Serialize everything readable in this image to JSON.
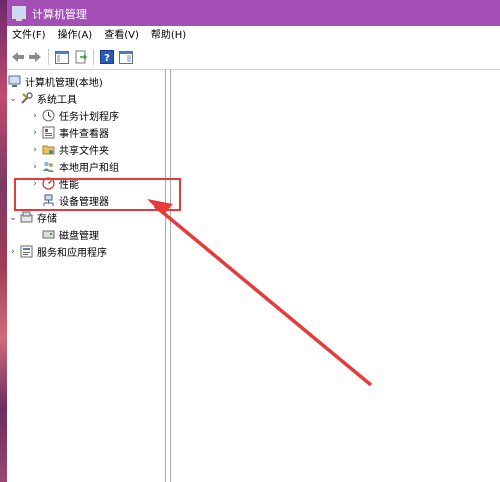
{
  "window": {
    "title": "计算机管理"
  },
  "menu": [
    {
      "label": "文件(F)"
    },
    {
      "label": "操作(A)"
    },
    {
      "label": "查看(V)"
    },
    {
      "label": "帮助(H)"
    }
  ],
  "tree": {
    "root": "计算机管理(本地)",
    "system_tools": "系统工具",
    "task_scheduler": "任务计划程序",
    "event_viewer": "事件查看器",
    "shared_folders": "共享文件夹",
    "local_users": "本地用户和组",
    "performance": "性能",
    "device_manager": "设备管理器",
    "storage": "存储",
    "disk_management": "磁盘管理",
    "services_apps": "服务和应用程序"
  },
  "colors": {
    "titlebar": "#a34fb5",
    "annotation": "#e83a3a"
  }
}
